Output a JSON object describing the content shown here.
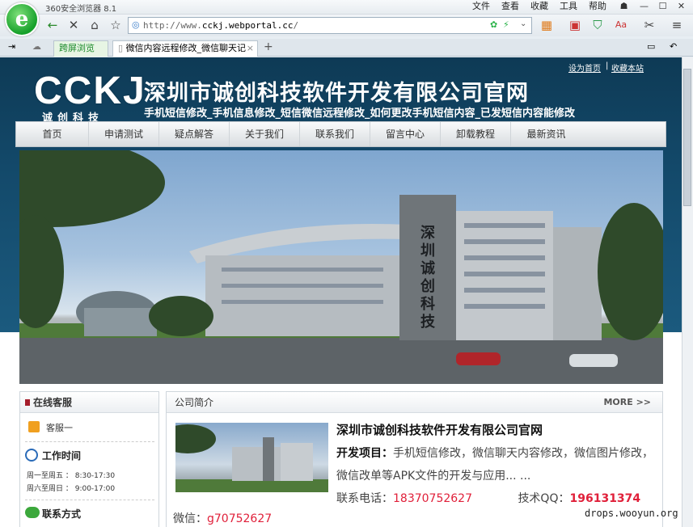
{
  "browser": {
    "title": "360安全浏览器 8.1",
    "menus": [
      "文件",
      "查看",
      "收藏",
      "工具",
      "帮助"
    ],
    "url_prefix": "http://www.",
    "url_domain": "cckj.webportal.cc",
    "url_suffix": "/",
    "tabs": [
      {
        "label": "跨屏浏览"
      },
      {
        "label": "微信内容远程修改_微信聊天记"
      }
    ]
  },
  "site": {
    "top_links": [
      "设为首页",
      "收藏本站"
    ],
    "brand_big": "CCKJ",
    "brand_small": "诚创科技",
    "company": "深圳市诚创科技软件开发有限公司官网",
    "slogan": "手机短信修改_手机信息修改_短信微信远程修改_如何更改手机短信内容_已发短信内容能修改",
    "nav": [
      "首页",
      "申请测试",
      "疑点解答",
      "关于我们",
      "联系我们",
      "留言中心",
      "卸载教程",
      "最新资讯"
    ],
    "building_sign": "深圳诚创科技"
  },
  "sidebar": {
    "title": "在线客服",
    "service": "客服一",
    "hours_title": "工作时间",
    "hours": [
      "周一至周五 ： 8:30-17:30",
      "周六至周日 ： 9:00-17:00"
    ],
    "contact_title": "联系方式"
  },
  "intro": {
    "title": "公司简介",
    "more": "MORE >>",
    "company": "深圳市诚创科技软件开发有限公司官网",
    "project_label": "开发项目：",
    "project_text": "手机短信修改，微信聊天内容修改，微信图片修改，微信改单等APK文件的开发与应用... ...",
    "phone_label": "联系电话：",
    "phone": "18370752627",
    "qq_label": "技术QQ：",
    "qq": "196131374",
    "wechat_label": "微信：",
    "wechat": "g70752627"
  },
  "watermark": "drops.wooyun.org"
}
